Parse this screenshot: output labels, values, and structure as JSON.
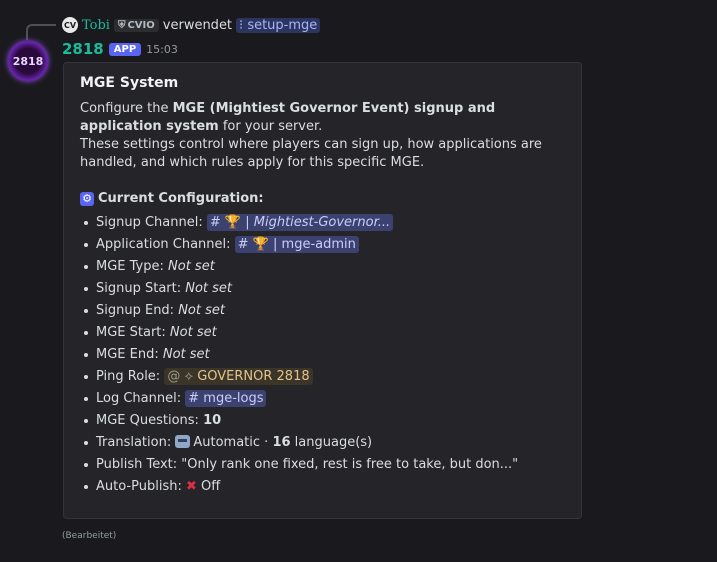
{
  "reply": {
    "avatar_text": "CV",
    "user": "Tobi",
    "tag": "CVIO",
    "text": "verwendet",
    "command": "setup-mge"
  },
  "message": {
    "avatar_text": "2818",
    "username": "2818",
    "badge": "APP",
    "time": "15:03",
    "edited": "(Bearbeitet)"
  },
  "embed": {
    "title": "MGE System",
    "desc_prefix": "Configure the ",
    "desc_bold": "MGE (Mightiest Governor Event) signup and application system",
    "desc_suffix": " for your server.",
    "desc_line2": "These settings control where players can sign up, how applications are handled, and which rules apply for this specific MGE.",
    "config_heading": "Current Configuration:",
    "items": {
      "signup_channel_label": "Signup Channel: ",
      "signup_channel_value": "| Mightiest-Governor...",
      "application_channel_label": "Application Channel: ",
      "application_channel_value": "| mge-admin",
      "mge_type_label": "MGE Type: ",
      "mge_type_value": "Not set",
      "signup_start_label": "Signup Start: ",
      "signup_start_value": "Not set",
      "signup_end_label": "Signup End: ",
      "signup_end_value": "Not set",
      "mge_start_label": "MGE Start: ",
      "mge_start_value": "Not set",
      "mge_end_label": "MGE End: ",
      "mge_end_value": "Not set",
      "ping_role_label": "Ping Role: ",
      "ping_role_value": "GOVERNOR 2818",
      "log_channel_label": "Log Channel: ",
      "log_channel_value": "mge-logs",
      "mge_questions_label": "MGE Questions: ",
      "mge_questions_value": "10",
      "translation_label": "Translation: ",
      "translation_mode": "Automatic",
      "translation_sep": " · ",
      "translation_count": "16",
      "translation_suffix": " language(s)",
      "publish_text_label": "Publish Text: ",
      "publish_text_value": "\"Only rank one fixed, rest is free to take, but don...\"",
      "auto_publish_label": "Auto-Publish: ",
      "auto_publish_value": "Off"
    }
  }
}
